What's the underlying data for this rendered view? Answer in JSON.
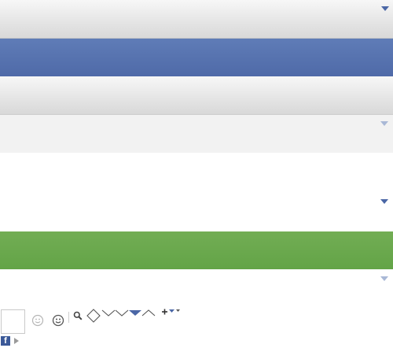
{
  "bands": [
    {
      "id": "band-1",
      "style": "gray-gradient"
    },
    {
      "id": "band-2",
      "style": "blue"
    },
    {
      "id": "band-3",
      "style": "gray-gradient"
    },
    {
      "id": "band-4",
      "style": "light-gray"
    },
    {
      "id": "band-5",
      "style": "white"
    },
    {
      "id": "band-6",
      "style": "green"
    },
    {
      "id": "band-7",
      "style": "white"
    }
  ],
  "colors": {
    "blue": "#5874b3",
    "green": "#67a84b",
    "gray": "#d8d8d8",
    "accent_triangle": "#4b67a6"
  },
  "toolbar": {
    "icons": [
      "smiley-light-icon",
      "smiley-icon",
      "search-icon",
      "diamond-icon",
      "chevron-down-outline-icon",
      "chevron-down-outline-icon",
      "triangle-down-filled-icon",
      "chevron-up-outline-icon",
      "plus-dropdown-icon"
    ]
  },
  "footer": {
    "logo_icon": "facebook-icon",
    "play_icon": "play-icon",
    "logo_letter": "f"
  }
}
